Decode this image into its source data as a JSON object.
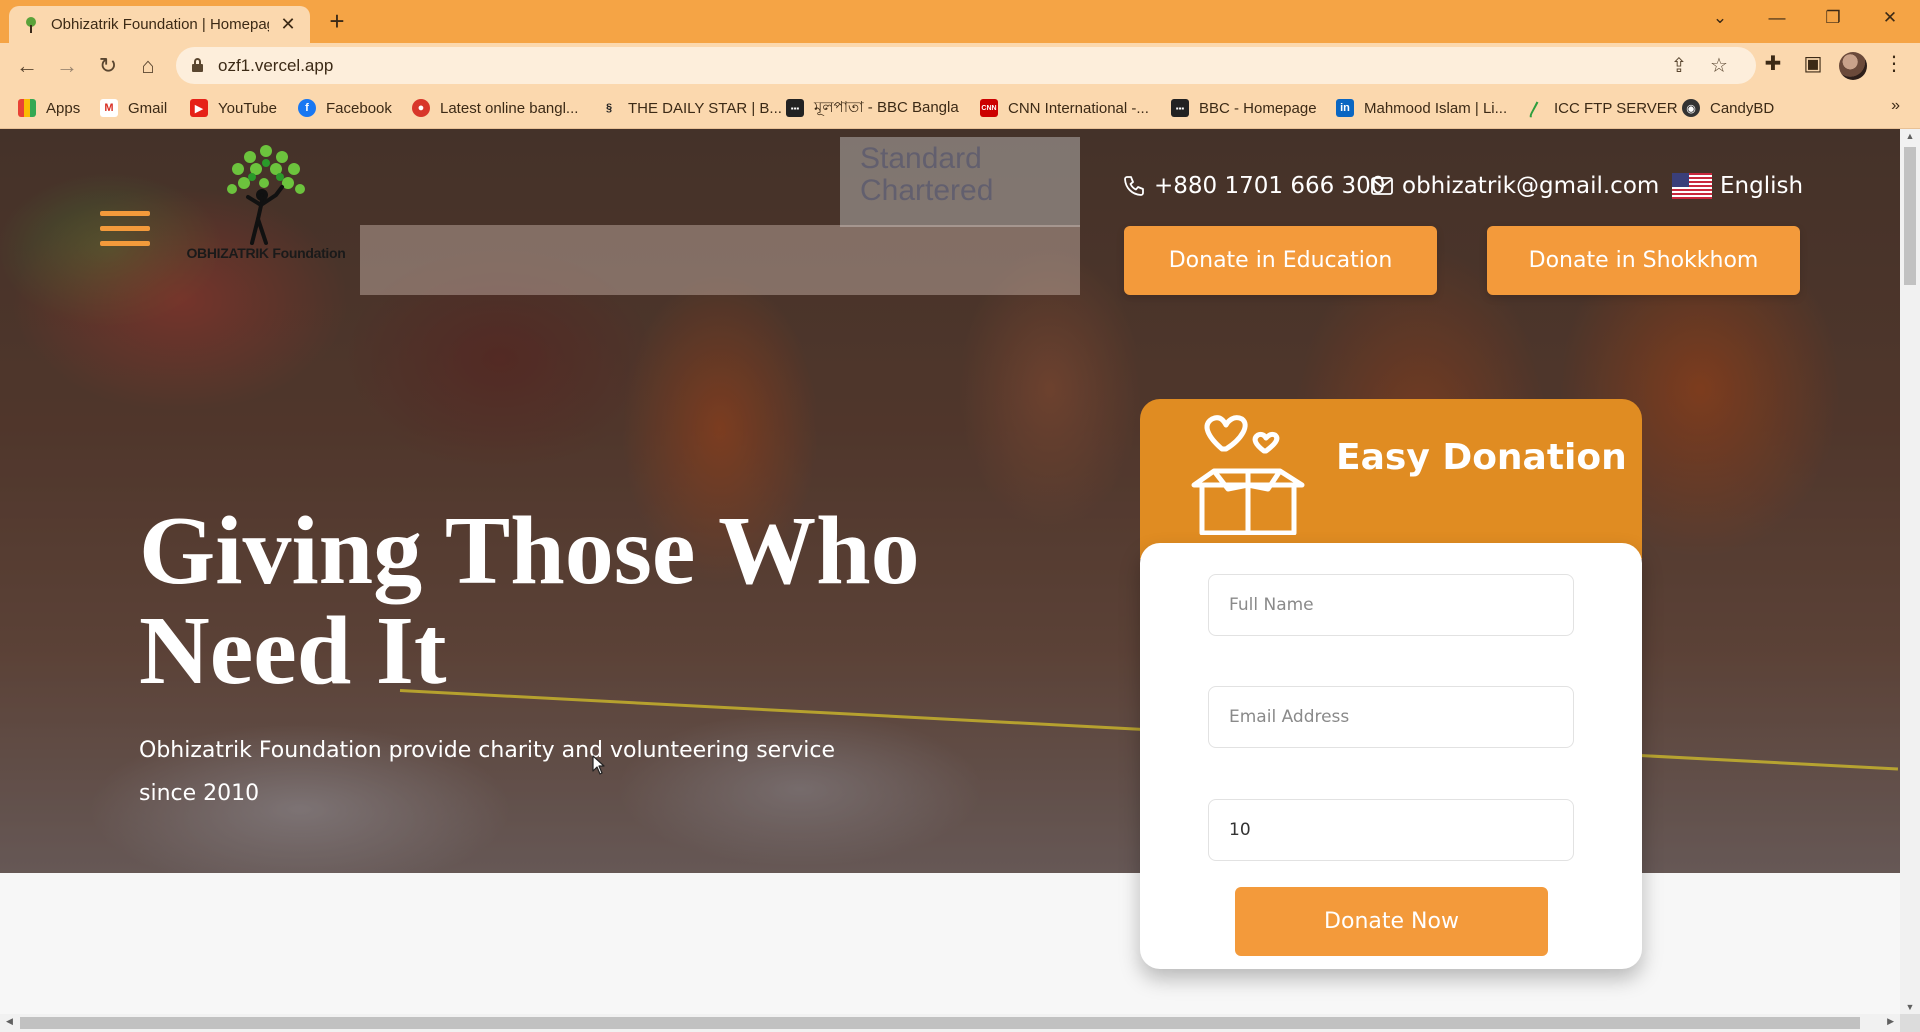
{
  "browser": {
    "tab_title": "Obhizatrik Foundation | Homepage",
    "url": "ozf1.vercel.app",
    "accent": "#f5a445"
  },
  "bookmarks": [
    {
      "label": "Apps",
      "icon": "apps-grid-icon"
    },
    {
      "label": "Gmail",
      "icon": "gmail-icon"
    },
    {
      "label": "YouTube",
      "icon": "youtube-icon"
    },
    {
      "label": "Facebook",
      "icon": "facebook-icon"
    },
    {
      "label": "Latest online bangl...",
      "icon": "bangla-news-icon"
    },
    {
      "label": "THE DAILY STAR | B...",
      "icon": "daily-star-icon"
    },
    {
      "label": "মূলপাতা - BBC Bangla",
      "icon": "bbc-icon"
    },
    {
      "label": "CNN International -...",
      "icon": "cnn-icon"
    },
    {
      "label": "BBC - Homepage",
      "icon": "bbc-icon"
    },
    {
      "label": "Mahmood Islam | Li...",
      "icon": "linkedin-icon"
    },
    {
      "label": "ICC FTP SERVER",
      "icon": "icc-icon"
    },
    {
      "label": "CandyBD",
      "icon": "candybd-icon"
    }
  ],
  "site": {
    "brand_color": "#f39a3b",
    "logo_text": "OBHIZATRIK Foundation",
    "phone": "+880 1701 666 300",
    "email": "obhizatrik@gmail.com",
    "language": "English",
    "buttons": {
      "education": "Donate in Education",
      "shokkhom": "Donate in Shokkhom"
    },
    "hero_sign": "Standard\nChartered",
    "headline": "Giving Those Who Need It",
    "subline": "Obhizatrik Foundation provide charity and volunteering service since 2010"
  },
  "donation": {
    "title": "Easy Donation",
    "name_placeholder": "Full Name",
    "email_placeholder": "Email Address",
    "amount_value": "10",
    "submit_label": "Donate Now"
  }
}
